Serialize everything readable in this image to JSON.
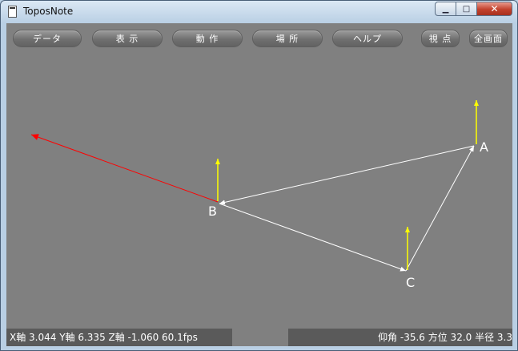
{
  "window": {
    "title": "ToposNote"
  },
  "toolbar": {
    "data": "データ",
    "view": "表 示",
    "action": "動 作",
    "place": "場 所",
    "help": "ヘルプ",
    "viewpoint": "視 点",
    "fullscreen": "全画面"
  },
  "scene": {
    "points": [
      {
        "label": "A"
      },
      {
        "label": "B"
      },
      {
        "label": "C"
      }
    ]
  },
  "status": {
    "left": "X軸  3.044 Y軸  6.335 Z軸 -1.060  60.1fps",
    "right": "仰角 -35.6 方位  32.0 半径   3.3"
  },
  "colors": {
    "up_vector": "#ffff00",
    "direction_vector": "#ff0000",
    "edge": "#ffffff",
    "background": "#808080"
  }
}
